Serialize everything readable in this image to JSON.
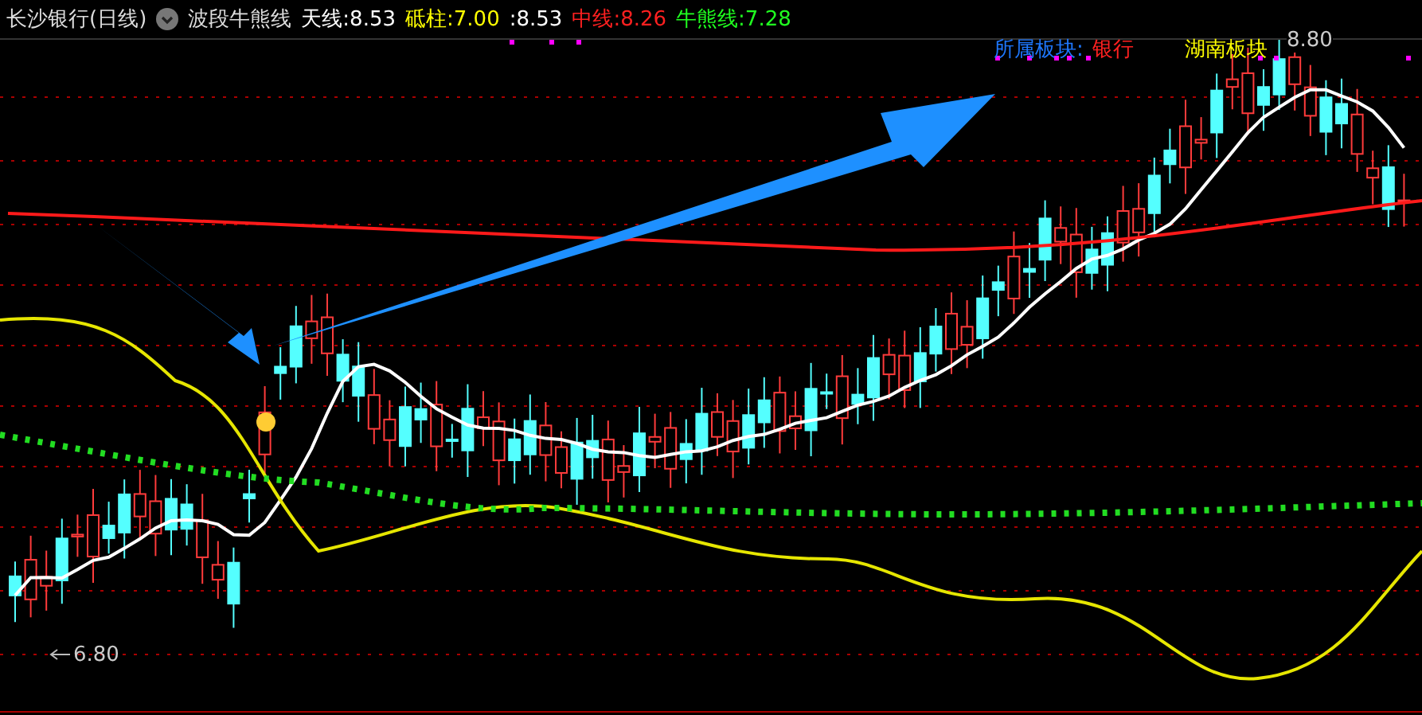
{
  "header": {
    "stock": "长沙银行(日线)",
    "indicator": "波段牛熊线",
    "items": [
      {
        "label": "天线:",
        "value": "8.53",
        "color": "#ffffff"
      },
      {
        "label": "砥柱:",
        "value": "7.00",
        "color": "#ffff00"
      },
      {
        "label": ":",
        "value": "8.53",
        "color": "#ffffff"
      },
      {
        "label": "中线:",
        "value": "8.26",
        "color": "#ff2020"
      },
      {
        "label": "牛熊线:",
        "value": "7.28",
        "color": "#20ff20"
      }
    ]
  },
  "sector": {
    "label": "所属板块:",
    "value": "银行",
    "region": "湖南板块"
  },
  "price_high": "8.80",
  "price_low": "6.80"
}
